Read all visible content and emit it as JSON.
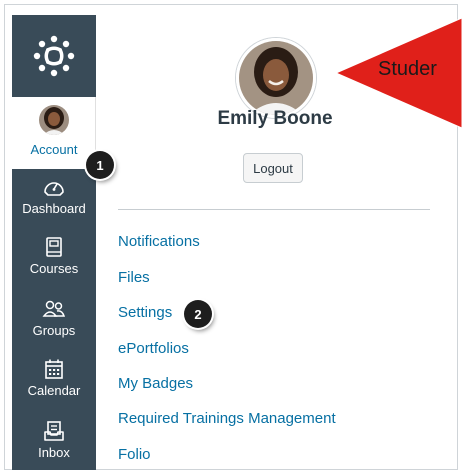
{
  "sidebar": {
    "account_label": "Account",
    "items": [
      {
        "label": "Dashboard",
        "icon": "dashboard-icon"
      },
      {
        "label": "Courses",
        "icon": "courses-icon"
      },
      {
        "label": "Groups",
        "icon": "groups-icon"
      },
      {
        "label": "Calendar",
        "icon": "calendar-icon"
      },
      {
        "label": "Inbox",
        "icon": "inbox-icon"
      }
    ]
  },
  "profile": {
    "name": "Emily Boone",
    "logout_label": "Logout"
  },
  "links": [
    "Notifications",
    "Files",
    "Settings",
    "ePortfolios",
    "My Badges",
    "Required Trainings Management",
    "Folio"
  ],
  "annotations": {
    "callout_1": "1",
    "callout_2": "2",
    "arrow_text": "Studer"
  },
  "colors": {
    "sidebar_bg": "#394b58",
    "link": "#0770a3",
    "arrow": "#e0201a"
  }
}
